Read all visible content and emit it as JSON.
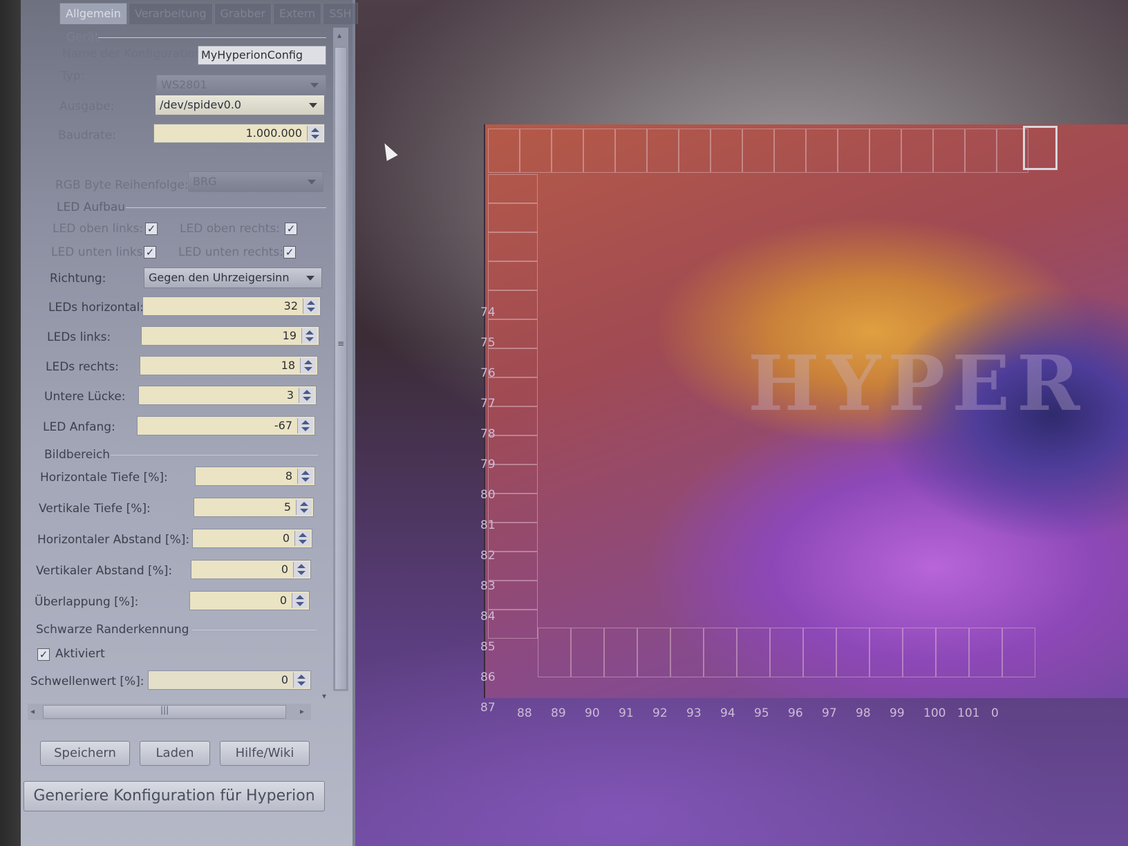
{
  "tabs": [
    "Allgemein",
    "Verarbeitung",
    "Grabber",
    "Extern",
    "SSH"
  ],
  "device": {
    "group_title": "Gerät",
    "config_name_label": "Name der Konfiguration:",
    "config_name_value": "MyHyperionConfig",
    "type_label": "Typ:",
    "type_value": "WS2801",
    "output_label": "Ausgabe:",
    "output_value": "/dev/spidev0.0",
    "baudrate_label": "Baudrate:",
    "baudrate_value": "1.000.000",
    "rgb_order_label": "RGB Byte Reihenfolge:",
    "rgb_order_value": "BRG"
  },
  "led_layout": {
    "group_title": "LED Aufbau",
    "top_left_label": "LED oben links:",
    "top_left_checked": true,
    "top_right_label": "LED oben rechts:",
    "top_right_checked": true,
    "bottom_left_label": "LED unten links:",
    "bottom_left_checked": true,
    "bottom_right_label": "LED unten rechts:",
    "bottom_right_checked": true,
    "direction_label": "Richtung:",
    "direction_value": "Gegen den Uhrzeigersinn",
    "leds_horizontal_label": "LEDs horizontal:",
    "leds_horizontal_value": "32",
    "leds_left_label": "LEDs links:",
    "leds_left_value": "19",
    "leds_right_label": "LEDs rechts:",
    "leds_right_value": "18",
    "bottom_gap_label": "Untere Lücke:",
    "bottom_gap_value": "3",
    "led_start_label": "LED Anfang:",
    "led_start_value": "-67"
  },
  "image_area": {
    "group_title": "Bildbereich",
    "horizontal_depth_label": "Horizontale Tiefe [%]:",
    "horizontal_depth_value": "8",
    "vertical_depth_label": "Vertikale Tiefe [%]:",
    "vertical_depth_value": "5",
    "horizontal_gap_label": "Horizontaler Abstand [%]:",
    "horizontal_gap_value": "0",
    "vertical_gap_label": "Vertikaler Abstand [%]:",
    "vertical_gap_value": "0",
    "overlap_label": "Überlappung [%]:",
    "overlap_value": "0"
  },
  "black_border": {
    "group_title": "Schwarze Randerkennung",
    "enabled_label": "Aktiviert",
    "enabled_checked": true,
    "threshold_label": "Schwellenwert [%]:",
    "threshold_value": "0"
  },
  "buttons": {
    "save": "Speichern",
    "load": "Laden",
    "help": "Hilfe/Wiki",
    "generate": "Generiere Konfiguration für Hyperion"
  },
  "preview": {
    "watermark": "HYPER",
    "left_numbers": [
      "74",
      "75",
      "76",
      "77",
      "78",
      "79",
      "80",
      "81",
      "82",
      "83",
      "84",
      "85",
      "86",
      "87"
    ],
    "bottom_numbers": [
      "88",
      "89",
      "90",
      "91",
      "92",
      "93",
      "94",
      "95",
      "96",
      "97",
      "98",
      "99",
      "100",
      "101",
      "0"
    ]
  },
  "check_glyph": "✓",
  "scroll_grip_glyph": "|||",
  "scroll_grip_vertical": "≡",
  "arrow_left": "◂",
  "arrow_right": "▸",
  "arrow_up": "▴",
  "arrow_down": "▾"
}
